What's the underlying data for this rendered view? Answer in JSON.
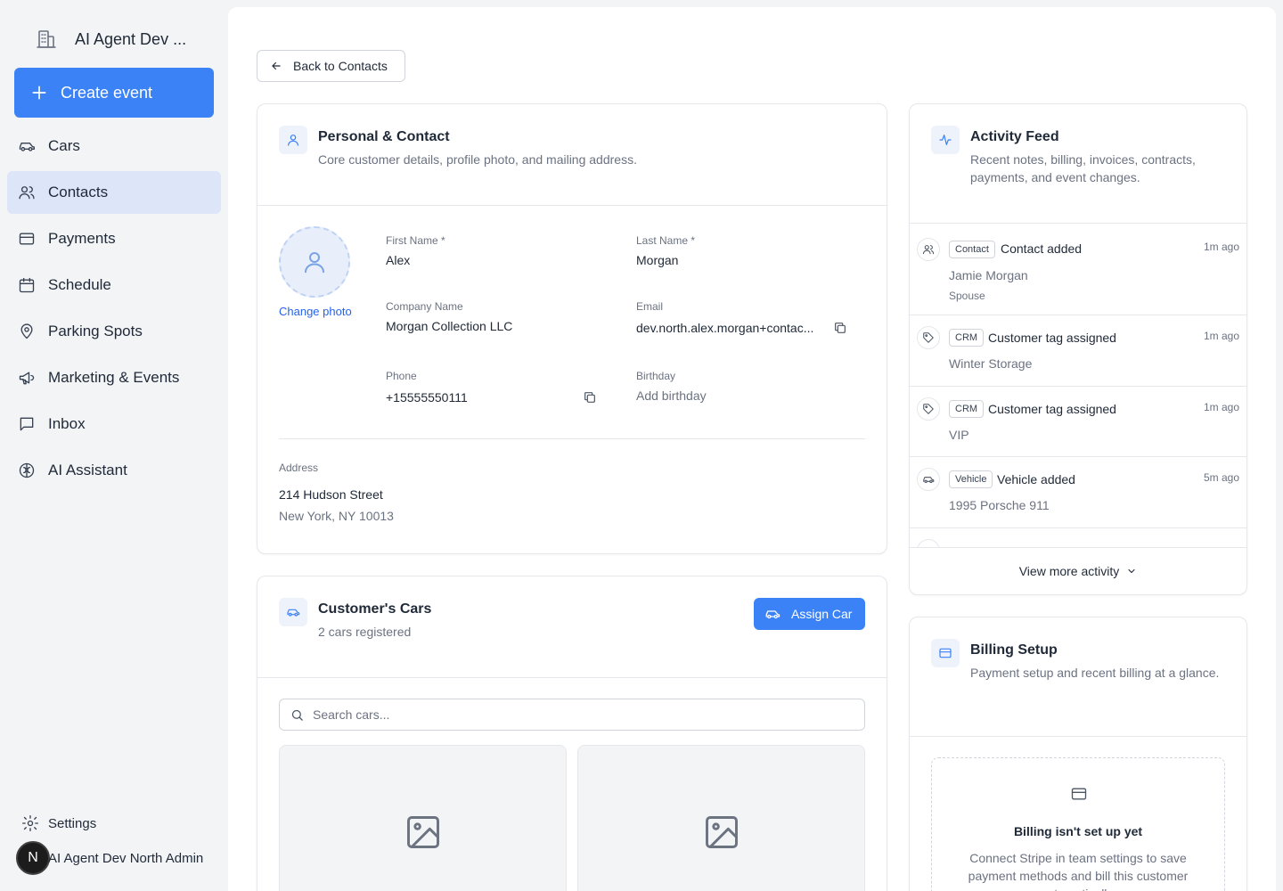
{
  "sidebar": {
    "brand": "AI Agent Dev ...",
    "create_event": "Create event",
    "items": [
      {
        "label": "Cars",
        "icon": "car-icon"
      },
      {
        "label": "Contacts",
        "icon": "users-icon",
        "active": true
      },
      {
        "label": "Payments",
        "icon": "credit-card-icon"
      },
      {
        "label": "Schedule",
        "icon": "calendar-icon"
      },
      {
        "label": "Parking Spots",
        "icon": "map-pin-icon"
      },
      {
        "label": "Marketing & Events",
        "icon": "megaphone-icon"
      },
      {
        "label": "Inbox",
        "icon": "message-square-icon"
      },
      {
        "label": "AI Assistant",
        "icon": "brain-icon"
      }
    ],
    "settings": "Settings",
    "user_initial": "N",
    "user_name": "AI Agent Dev North Admin"
  },
  "back_button": "Back to Contacts",
  "personal": {
    "title": "Personal & Contact",
    "subtitle": "Core customer details, profile photo, and mailing address.",
    "change_photo": "Change photo",
    "first_name_label": "First Name *",
    "first_name": "Alex",
    "last_name_label": "Last Name *",
    "last_name": "Morgan",
    "company_label": "Company Name",
    "company": "Morgan Collection LLC",
    "email_label": "Email",
    "email": "dev.north.alex.morgan+contac...",
    "phone_label": "Phone",
    "phone": "+15555550111",
    "birthday_label": "Birthday",
    "birthday_placeholder": "Add birthday",
    "address_label": "Address",
    "address_line1": "214 Hudson Street",
    "address_line2": "New York, NY 10013"
  },
  "cars": {
    "title": "Customer's Cars",
    "subtitle": "2 cars registered",
    "assign_button": "Assign Car",
    "search_placeholder": "Search cars..."
  },
  "activity": {
    "title": "Activity Feed",
    "subtitle": "Recent notes, billing, invoices, contracts, payments, and event changes.",
    "items": [
      {
        "badge": "Contact",
        "title": "Contact added",
        "time": "1m ago",
        "detail": "Jamie Morgan",
        "sub": "Spouse"
      },
      {
        "badge": "CRM",
        "title": "Customer tag assigned",
        "time": "1m ago",
        "detail": "Winter Storage"
      },
      {
        "badge": "CRM",
        "title": "Customer tag assigned",
        "time": "1m ago",
        "detail": "VIP"
      },
      {
        "badge": "Vehicle",
        "title": "Vehicle added",
        "time": "5m ago",
        "detail": "1995 Porsche 911"
      }
    ],
    "view_more": "View more activity"
  },
  "billing": {
    "title": "Billing Setup",
    "subtitle": "Payment setup and recent billing at a glance.",
    "empty_title": "Billing isn't set up yet",
    "empty_text": "Connect Stripe in team settings to save payment methods and bill this customer automatically."
  },
  "colors": {
    "accent": "#3b82f6",
    "active_nav": "#dde5f9",
    "link": "#2563eb"
  }
}
